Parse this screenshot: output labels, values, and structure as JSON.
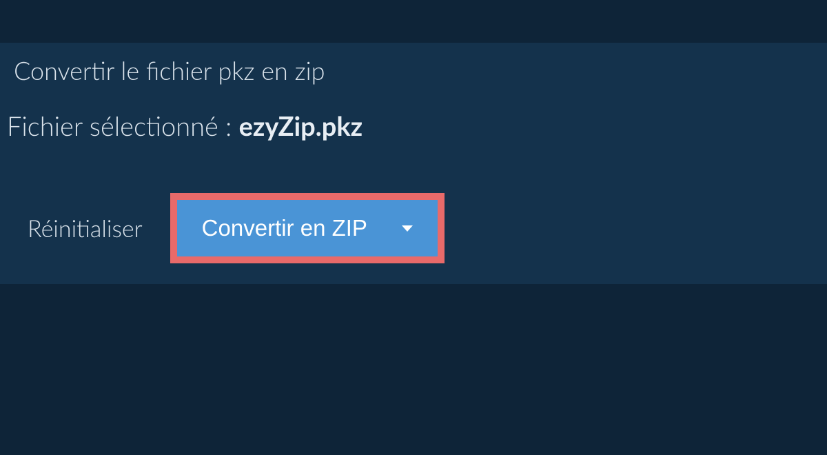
{
  "tab": {
    "title": "Convertir le fichier pkz en zip"
  },
  "selected": {
    "label": "Fichier sélectionné : ",
    "filename": "ezyZip.pkz"
  },
  "actions": {
    "reset_label": "Réinitialiser",
    "convert_label": "Convertir en ZIP"
  }
}
